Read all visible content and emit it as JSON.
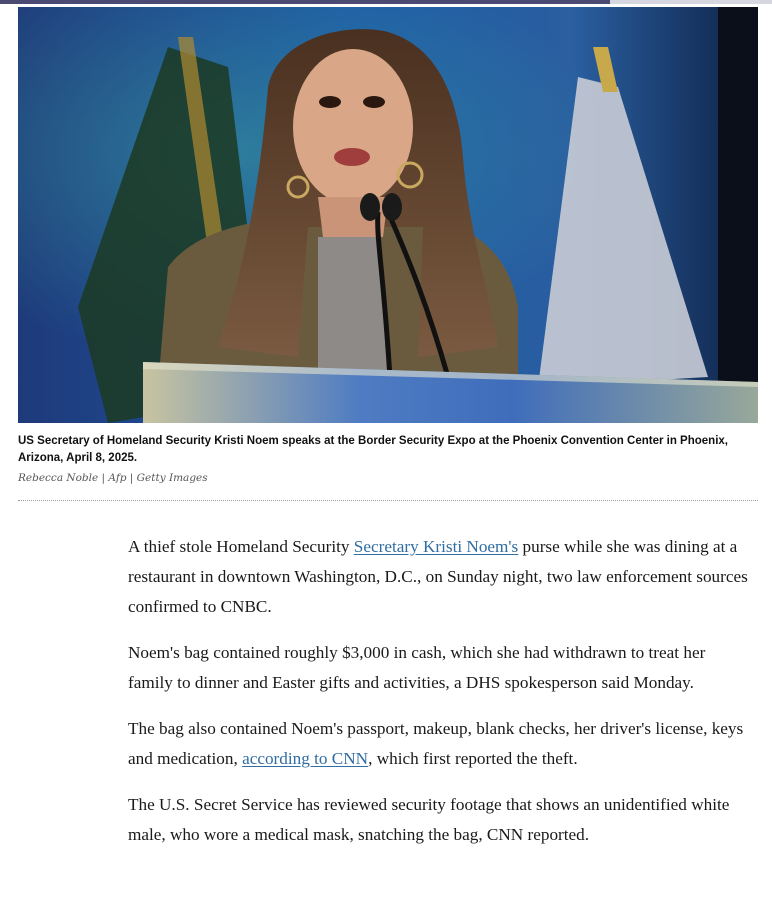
{
  "image": {
    "description_icon": "photo-speaker-at-podium"
  },
  "caption": {
    "text": "US Secretary of Homeland Security Kristi Noem speaks at the Border Security Expo at the Phoenix Convention Center in Phoenix, Arizona, April 8, 2025.",
    "credit": "Rebecca Noble | Afp | Getty Images"
  },
  "article": {
    "p1": {
      "before": "A thief stole Homeland Security ",
      "link": "Secretary Kristi Noem's",
      "after": " purse while she was dining at a restaurant in downtown Washington, D.C., on Sunday night, two law enforcement sources confirmed to CNBC."
    },
    "p2": "Noem's bag contained roughly $3,000 in cash, which she had withdrawn to treat her family to dinner and Easter gifts and activities, a DHS spokesperson said Monday.",
    "p3": {
      "before": "The bag also contained Noem's passport, makeup, blank checks, her driver's license, keys and medication, ",
      "link": "according to CNN",
      "after": ", which first reported the theft."
    },
    "p4": "The U.S. Secret Service has reviewed security footage that shows an unidentified white male, who wore a medical mask, snatching the bag, CNN reported."
  },
  "colors": {
    "link": "#2f6da3",
    "top_rule": "#4a4a72"
  }
}
